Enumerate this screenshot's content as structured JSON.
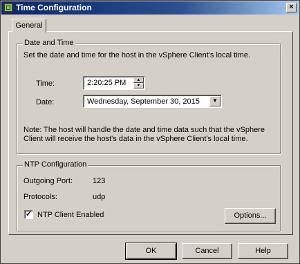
{
  "window": {
    "title": "Time Configuration",
    "close_glyph": "×",
    "app_icon": "vmware-logo"
  },
  "tabs": [
    {
      "label": "General",
      "selected": true
    }
  ],
  "date_time": {
    "section_title": "Date and Time",
    "description": "Set the date and time for the host in the vSphere Client's local time.",
    "time_label": "Time:",
    "time_value": "2:20:25 PM",
    "date_label": "Date:",
    "date_value": "Wednesday, September 30, 2015",
    "note_line1": "Note: The host will handle the date and time data such that the vSphere",
    "note_line2": "Client will receive the host's data in the vSphere Client's local time."
  },
  "ntp": {
    "section_title": "NTP Configuration",
    "port_label": "Outgoing Port:",
    "port_value": "123",
    "protocols_label": "Protocols:",
    "protocols_value": "udp",
    "client_enabled_label": "NTP Client Enabled",
    "client_enabled": true,
    "options_label": "Options..."
  },
  "footer": {
    "ok_label": "OK",
    "cancel_label": "Cancel",
    "help_label": "Help"
  }
}
